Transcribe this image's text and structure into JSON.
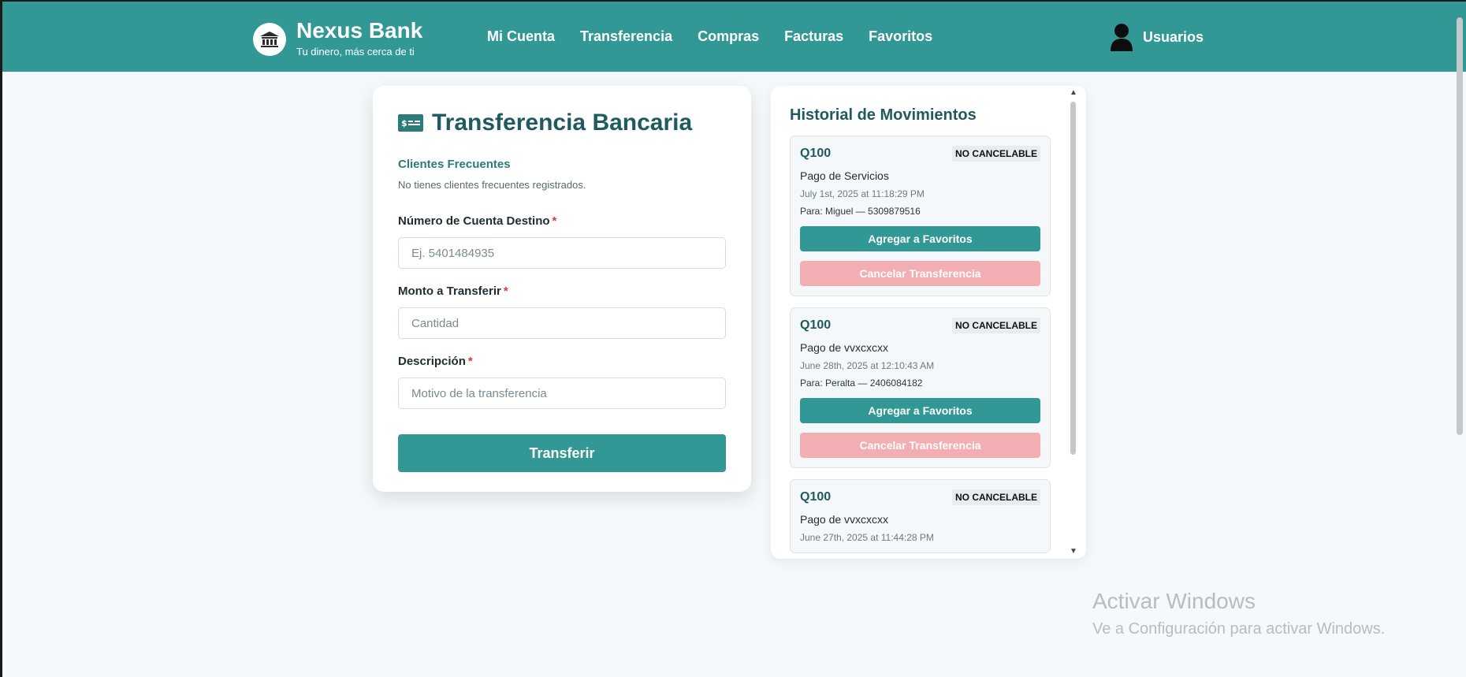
{
  "app": {
    "name": "Nexus Bank",
    "tagline": "Tu dinero, más cerca de ti"
  },
  "nav": {
    "items": [
      {
        "label": "Mi Cuenta"
      },
      {
        "label": "Transferencia"
      },
      {
        "label": "Compras"
      },
      {
        "label": "Facturas"
      },
      {
        "label": "Favoritos"
      }
    ],
    "user_label": "Usuarios"
  },
  "transfer": {
    "title": "Transferencia Bancaria",
    "frequent_title": "Clientes Frecuentes",
    "frequent_note": "No tienes clientes frecuentes registrados.",
    "required_mark": "*",
    "account": {
      "label": "Número de Cuenta Destino",
      "value": "",
      "placeholder": "Ej. 5401484935"
    },
    "amount": {
      "label": "Monto a Transferir",
      "value": "",
      "placeholder": "Cantidad"
    },
    "description": {
      "label": "Descripción",
      "value": "",
      "placeholder": "Motivo de la transferencia"
    },
    "submit_label": "Transferir"
  },
  "history": {
    "title": "Historial de Movimientos",
    "items": [
      {
        "amount": "Q100",
        "badge": "NO CANCELABLE",
        "description": "Pago de Servicios",
        "date": "July 1st, 2025 at 11:18:29 PM",
        "destination": "Para: Miguel — 5309879516",
        "favorite_label": "Agregar a Favoritos",
        "cancel_label": "Cancelar Transferencia"
      },
      {
        "amount": "Q100",
        "badge": "NO CANCELABLE",
        "description": "Pago de vvxcxcxx",
        "date": "June 28th, 2025 at 12:10:43 AM",
        "destination": "Para: Peralta — 2406084182",
        "favorite_label": "Agregar a Favoritos",
        "cancel_label": "Cancelar Transferencia"
      },
      {
        "amount": "Q100",
        "badge": "NO CANCELABLE",
        "description": "Pago de vvxcxcxx",
        "date": "June 27th, 2025 at 11:44:28 PM",
        "destination": "",
        "favorite_label": "",
        "cancel_label": ""
      }
    ]
  },
  "watermark": {
    "title": "Activar Windows",
    "subtitle": "Ve a Configuración para activar Windows."
  },
  "colors": {
    "primary": "#329895",
    "heading": "#1e5a5e",
    "cancel_disabled": "#f2aeb2",
    "required": "#d73a3a"
  },
  "icons": {
    "brand": "bank-icon",
    "user": "user-icon",
    "title": "money-bill-icon"
  }
}
